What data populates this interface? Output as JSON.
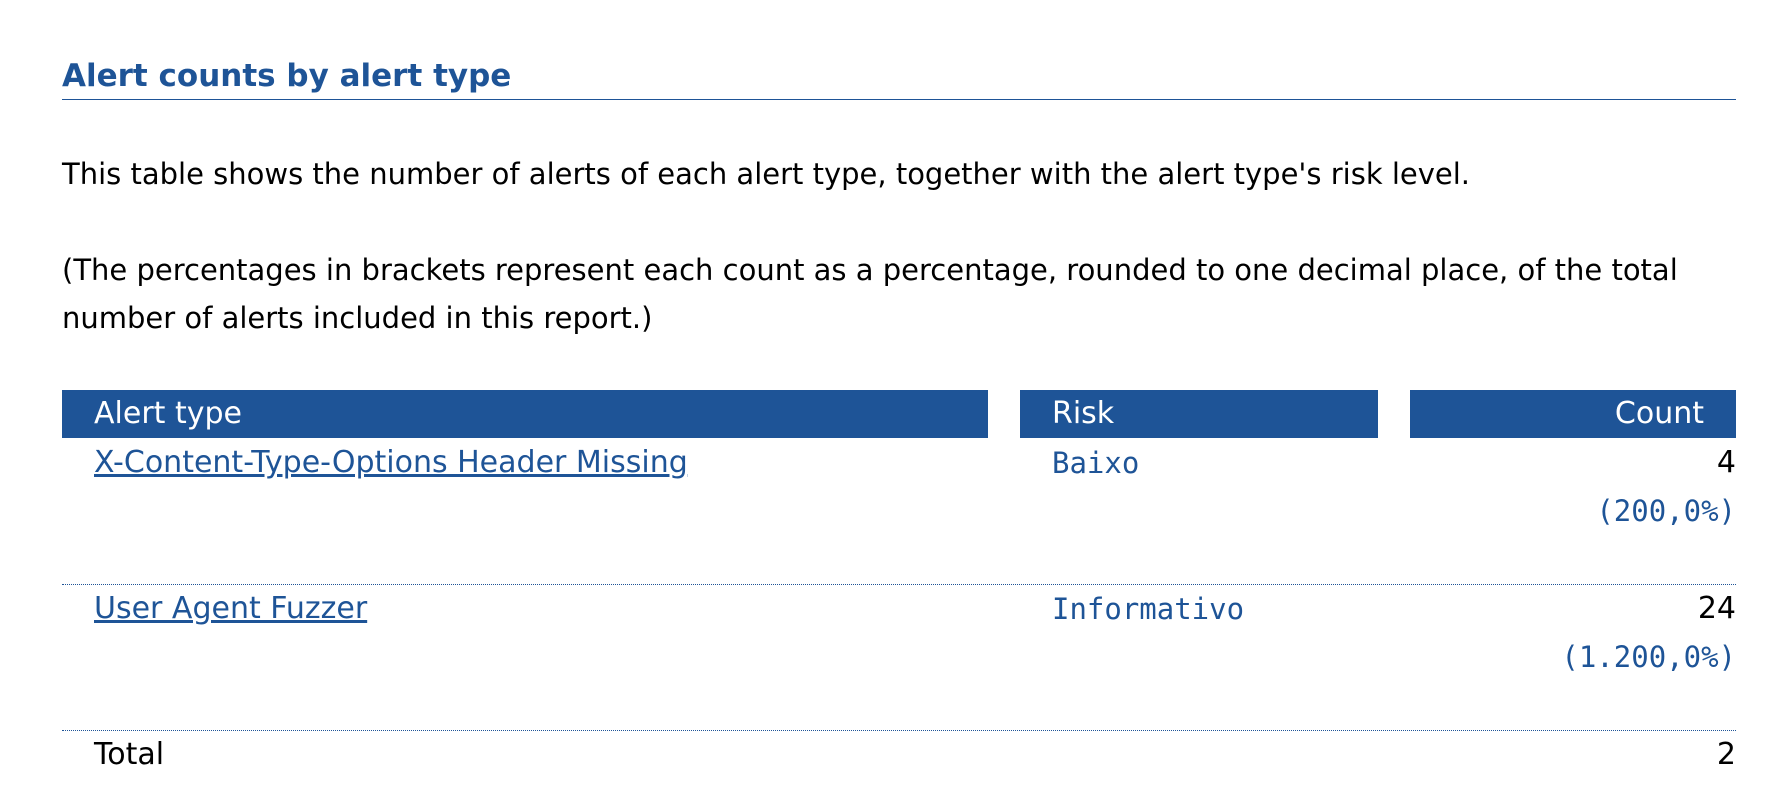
{
  "section": {
    "title": "Alert counts by alert type"
  },
  "intro": {
    "paragraph1": "This table shows the number of alerts of each alert type, together with the alert type's risk level.",
    "paragraph2": "(The percentages in brackets represent each count as a percentage, rounded to one decimal place, of the total number of alerts included in this report.)"
  },
  "table": {
    "headers": {
      "alert_type": "Alert type",
      "risk": "Risk",
      "count": "Count"
    },
    "rows": [
      {
        "alert_type": "X-Content-Type-Options Header Missing",
        "risk": "Baixo",
        "count": "4",
        "percentage": "(200,0%)"
      },
      {
        "alert_type": "User Agent Fuzzer",
        "risk": "Informativo",
        "count": "24",
        "percentage": "(1.200,0%)"
      }
    ],
    "total": {
      "label": "Total",
      "value": "2"
    }
  },
  "colors": {
    "accent": "#1e5497",
    "header_text": "#ffffff",
    "body_text": "#000000"
  }
}
